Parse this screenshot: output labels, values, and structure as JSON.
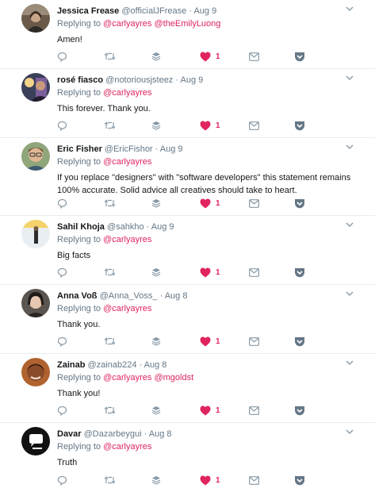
{
  "tweets": [
    {
      "name": "Jessica Frease",
      "handle": "@officialJFrease",
      "date": "Aug 9",
      "reply_prefix": "Replying to",
      "mentions": [
        "@carlyayres",
        "@theEmilyLuong"
      ],
      "text": "Amen!",
      "likes": "1"
    },
    {
      "name": "rosé fiasco",
      "handle": "@notoriousjsteez",
      "date": "Aug 9",
      "reply_prefix": "Replying to",
      "mentions": [
        "@carlyayres"
      ],
      "text": "This forever. Thank you.",
      "likes": "1"
    },
    {
      "name": "Eric Fisher",
      "handle": "@EricFishor",
      "date": "Aug 9",
      "reply_prefix": "Replying to",
      "mentions": [
        "@carlyayres"
      ],
      "text": "If you replace \"designers\" with \"software developers\" this statement remains 100% accurate. Solid advice all creatives should take to heart.",
      "likes": "1"
    },
    {
      "name": "Sahil Khoja",
      "handle": "@sahkho",
      "date": "Aug 9",
      "reply_prefix": "Replying to",
      "mentions": [
        "@carlyayres"
      ],
      "text": "Big facts",
      "likes": "1"
    },
    {
      "name": "Anna Voß",
      "handle": "@Anna_Voss_",
      "date": "Aug 8",
      "reply_prefix": "Replying to",
      "mentions": [
        "@carlyayres"
      ],
      "text": "Thank you.",
      "likes": "1"
    },
    {
      "name": "Zainab",
      "handle": "@zainab224",
      "date": "Aug 8",
      "reply_prefix": "Replying to",
      "mentions": [
        "@carlyayres",
        "@mgoldst"
      ],
      "text": "Thank you!",
      "likes": "1"
    },
    {
      "name": "Davar",
      "handle": "@Dazarbeygui",
      "date": "Aug 8",
      "reply_prefix": "Replying to",
      "mentions": [
        "@carlyayres"
      ],
      "text": "Truth",
      "likes": "1"
    }
  ],
  "separator": "·",
  "colors": {
    "like": "#e0245e",
    "mention": "#e0245e",
    "muted": "#657786",
    "border": "#e6ecf0"
  },
  "icons": [
    "reply-icon",
    "retweet-icon",
    "stack-icon",
    "heart-icon",
    "mail-icon",
    "pocket-icon",
    "chevron-down-icon"
  ]
}
